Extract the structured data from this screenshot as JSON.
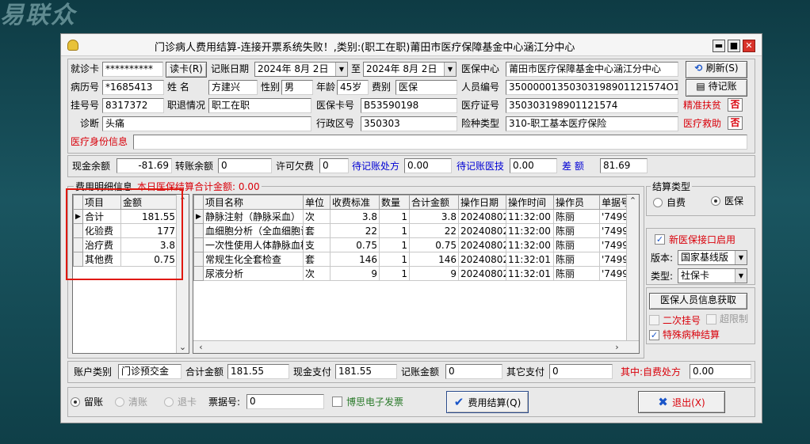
{
  "background": {
    "logo_text": "易联众"
  },
  "window": {
    "title": "门诊病人费用结算-连接开票系统失败！,类别:(职工在职)莆田市医疗保障基金中心涵江分中心",
    "min_label": "▬",
    "max_label": "■",
    "close_label": "✕"
  },
  "patient": {
    "card_label": "就诊卡",
    "card_value": "**********",
    "read_card": "读卡(R)",
    "date_label": "记账日期",
    "date_from": "2024年 8月 2日",
    "to_label": "至",
    "date_to": "2024年 8月 2日",
    "center_label": "医保中心",
    "center_value": "莆田市医疗保障基金中心涵江分中心",
    "refresh": "刷新(S)",
    "pending": "待记账",
    "record_label": "病历号",
    "record_value": "*1685413",
    "name_label": "姓    名",
    "name_value": "方建兴",
    "sex_label": "性别",
    "sex_value": "男",
    "age_label": "年龄",
    "age_value": "45岁",
    "fee_type_label": "费别",
    "fee_type_value": "医保",
    "person_no_label": "人员编号",
    "person_no_value": "35000001350303198901121574O1",
    "reg_label": "挂号号",
    "reg_value": "8317372",
    "status_label": "职退情况",
    "status_value": "职工在职",
    "ins_card_label": "医保卡号",
    "ins_card_value": "B53590198",
    "cert_label": "医疗证号",
    "cert_value": "350303198901121574",
    "poverty_label": "精准扶贫",
    "poverty_value": "否",
    "diag_label": "诊断",
    "diag_value": "头痛",
    "region_label": "行政区号",
    "region_value": "350303",
    "risk_label": "险种类型",
    "risk_value": "310-职工基本医疗保险",
    "aid_label": "医疗救助",
    "aid_value": "否",
    "identity_label": "医疗身份信息",
    "identity_value": ""
  },
  "balance": {
    "cash_label": "现金余额",
    "cash_value": "-81.69",
    "transfer_label": "转账余额",
    "transfer_value": "0",
    "credit_label": "许可欠费",
    "credit_value": "0",
    "pending_rx_label": "待记账处方",
    "pending_rx_value": "0.00",
    "pending_tech_label": "待记账医技",
    "pending_tech_value": "0.00",
    "diff_label": "差    额",
    "diff_value": "81.69"
  },
  "detail": {
    "legend": "费用明细信息",
    "legend_note": "本日医保结算合计金额: 0.00",
    "summary_headers": [
      "项目",
      "金额"
    ],
    "summary_rows": [
      {
        "item": "合计",
        "amount": "181.55"
      },
      {
        "item": "化验费",
        "amount": "177"
      },
      {
        "item": "治疗费",
        "amount": "3.8"
      },
      {
        "item": "其他费",
        "amount": "0.75"
      }
    ],
    "item_headers": [
      "项目名称",
      "单位",
      "收费标准",
      "数量",
      "合计金额",
      "操作日期",
      "操作时间",
      "操作员",
      "单据号"
    ],
    "item_rows": [
      {
        "name": "静脉注射（静脉采血）",
        "unit": "次",
        "price": "3.8",
        "qty": "1",
        "total": "3.8",
        "date": "20240802",
        "time": "11:32:00",
        "operator": "陈丽",
        "doc": "'7499"
      },
      {
        "name": "血细胞分析（全血细胞计数）",
        "unit": "套",
        "price": "22",
        "qty": "1",
        "total": "22",
        "date": "20240802",
        "time": "11:32:00",
        "operator": "陈丽",
        "doc": "'7499"
      },
      {
        "name": "一次性使用人体静脉血样采集容器",
        "unit": "支",
        "price": "0.75",
        "qty": "1",
        "total": "0.75",
        "date": "20240802",
        "time": "11:32:00",
        "operator": "陈丽",
        "doc": "'7499"
      },
      {
        "name": "常规生化全套检查",
        "unit": "套",
        "price": "146",
        "qty": "1",
        "total": "146",
        "date": "20240802",
        "time": "11:32:01",
        "operator": "陈丽",
        "doc": "'7499"
      },
      {
        "name": "尿液分析",
        "unit": "次",
        "price": "9",
        "qty": "1",
        "total": "9",
        "date": "20240802",
        "time": "11:32:01",
        "operator": "陈丽",
        "doc": "'7499"
      }
    ]
  },
  "settle": {
    "legend": "结算类型",
    "self_pay": "自费",
    "insurance": "医保",
    "new_interface": "新医保接口启用",
    "version_label": "版本:",
    "version_value": "国家基线版",
    "type_label": "类型:",
    "type_value": "社保卡",
    "get_info": "医保人员信息获取",
    "second_reg": "二次挂号",
    "over_limit": "超限制",
    "special": "特殊病种结算"
  },
  "totals": {
    "account_type_label": "账户类别",
    "account_type_value": "门诊预交金",
    "total_label": "合计金额",
    "total_value": "181.55",
    "cash_pay_label": "现金支付",
    "cash_pay_value": "181.55",
    "credit_label": "记账金额",
    "credit_value": "0",
    "other_label": "其它支付",
    "other_value": "0",
    "self_rx_label": "其中:自费处方",
    "self_rx_value": "0.00"
  },
  "footer": {
    "keep": "留账",
    "clear": "清账",
    "refund": "退卡",
    "receipt_label": "票据号:",
    "receipt_value": "0",
    "einvoice": "博思电子发票",
    "settle_btn": "费用结算(Q)",
    "exit_btn": "退出(X)"
  }
}
